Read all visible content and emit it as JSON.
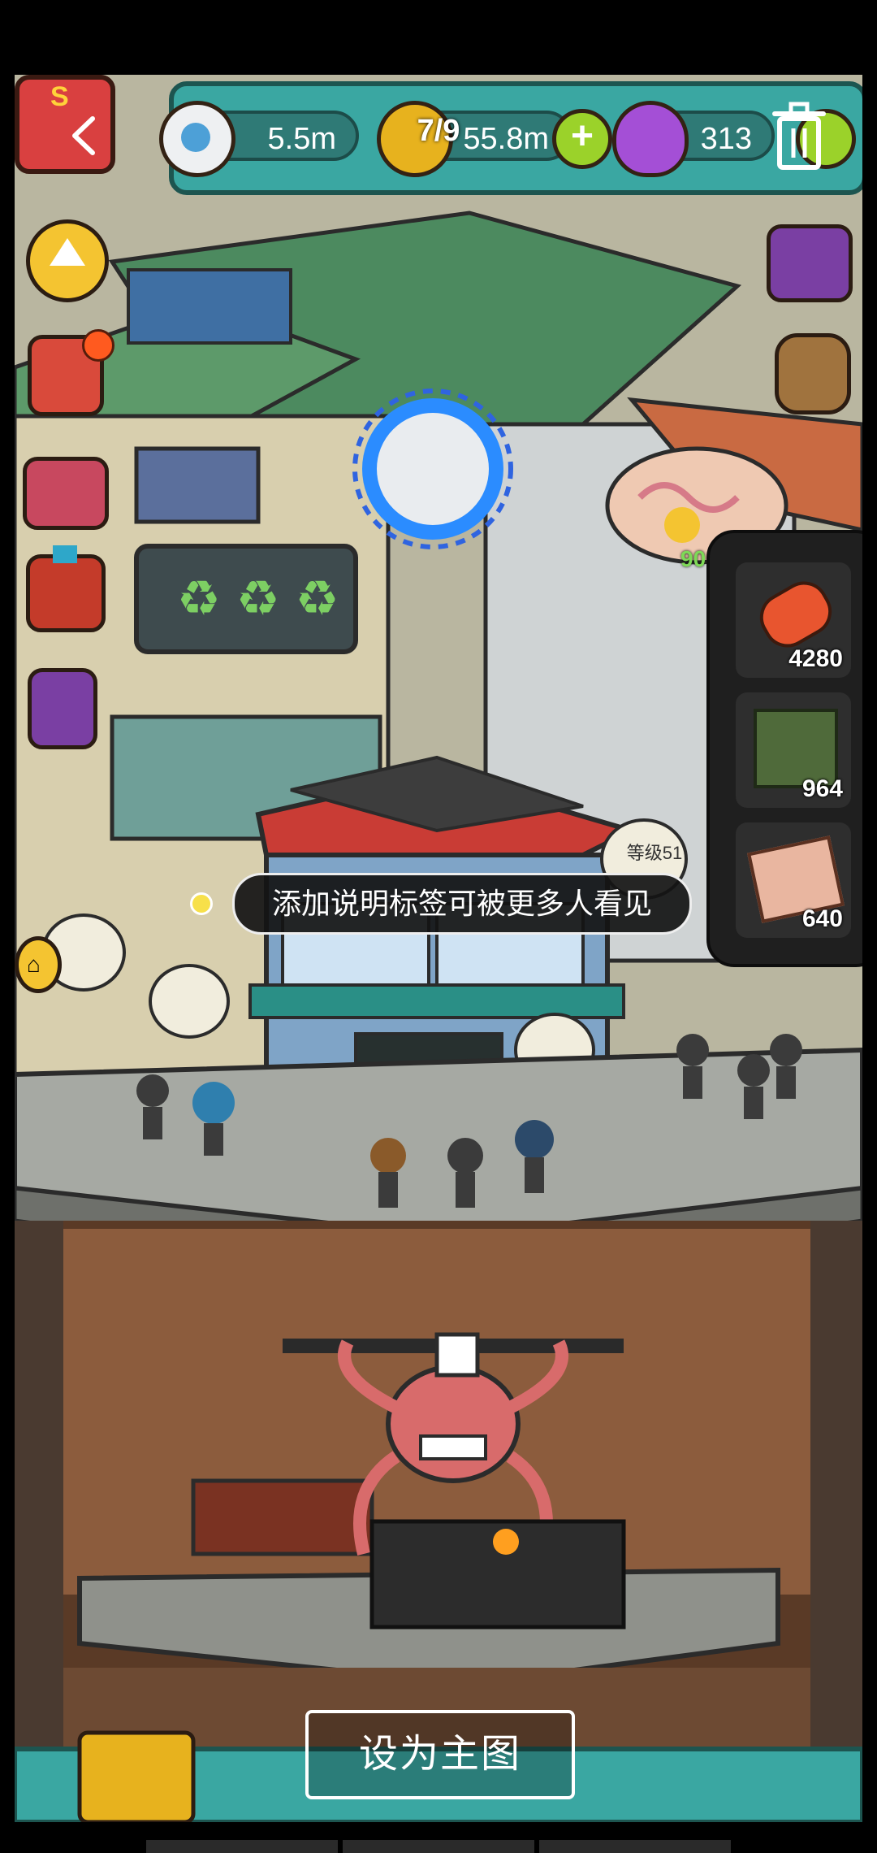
{
  "viewer": {
    "counter": "7/9",
    "set_main_label": "设为主图",
    "back_icon": "chevron-left-icon",
    "delete_icon": "trash-icon"
  },
  "game": {
    "resources": [
      {
        "icon": "eyeball-icon",
        "value": "5.5m"
      },
      {
        "icon": "gold-coin-icon",
        "value": "55.8m"
      },
      {
        "icon": "potion-icon",
        "value": "313"
      }
    ],
    "rank_badge": "S",
    "notification_value": "90",
    "building_level_label": "等级51",
    "description_tag": "添加说明标签可被更多人看见",
    "inventory_items": [
      {
        "icon": "meat-bone-icon",
        "count": "4280"
      },
      {
        "icon": "ingredient-crate-icon",
        "count": "964"
      },
      {
        "icon": "recipe-scroll-icon",
        "count": "640"
      }
    ]
  },
  "colors": {
    "hud_teal": "#3aa7a2",
    "coin_gold": "#e7b21e",
    "add_green": "#9bd22a",
    "potion_purple": "#a44fd6",
    "panel_dark": "#1f1f1f"
  }
}
